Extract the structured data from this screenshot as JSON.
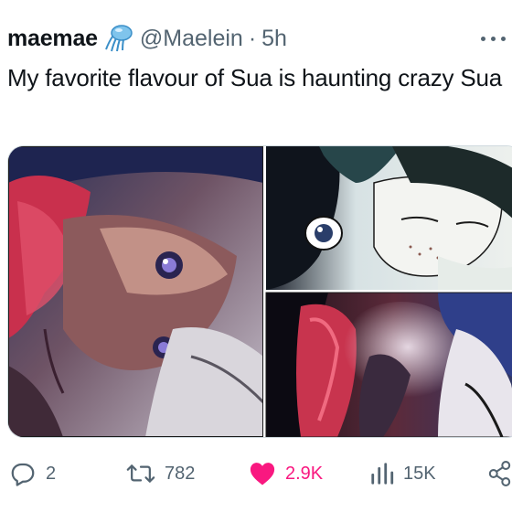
{
  "tweet": {
    "display_name": "maemae",
    "badge_icon": "jellyfish-emoji-icon",
    "handle": "@Maelein",
    "separator": "·",
    "time": "5h",
    "text": "My favorite flavour of Sua is haunting crazy Sua"
  },
  "media": {
    "images": [
      {
        "name": "manga-image-left"
      },
      {
        "name": "manga-image-top-right"
      },
      {
        "name": "manga-image-bottom-right"
      }
    ]
  },
  "actions": {
    "reply": {
      "icon": "reply-icon",
      "count": "2"
    },
    "repost": {
      "icon": "repost-icon",
      "count": "782"
    },
    "like": {
      "icon": "heart-icon",
      "count": "2.9K",
      "liked": true,
      "color": "#f91880"
    },
    "views": {
      "icon": "views-icon",
      "count": "15K"
    },
    "share": {
      "icon": "share-icon"
    }
  },
  "colors": {
    "text": "#0f1419",
    "secondary": "#536471",
    "like": "#f91880",
    "border": "#cfd9de"
  }
}
